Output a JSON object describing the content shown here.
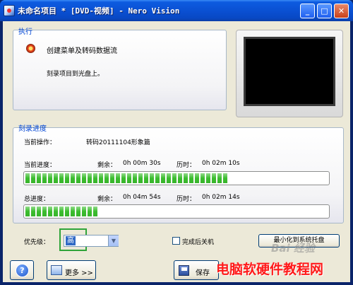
{
  "window": {
    "title": "未命名项目 * [DVD-视频] - Nero Vision",
    "minimize_glyph": "_",
    "maximize_glyph": "□",
    "close_glyph": "✕"
  },
  "execute": {
    "group_title": "执行",
    "step_title": "创建菜单及转码数据流",
    "step_detail": "刻录项目到光盘上。"
  },
  "progress": {
    "group_title": "刻录进度",
    "operation_label": "当前操作：",
    "operation_value": "转码20111104形象篇",
    "current": {
      "label": "当前进度：",
      "remaining_label": "剩余：",
      "remaining_value": "0h 00m 30s",
      "elapsed_label": "历时：",
      "elapsed_value": "0h 02m 10s",
      "fraction": 0.67
    },
    "total": {
      "label": "总进度：",
      "remaining_label": "剩余：",
      "remaining_value": "0h 04m 54s",
      "elapsed_label": "历时：",
      "elapsed_value": "0h 02m 14s",
      "fraction": 0.24
    }
  },
  "options": {
    "priority_label": "优先级：",
    "priority_value": "高",
    "shutdown_label": "完成后关机",
    "shutdown_checked": false,
    "minimize_tray_label": "最小化到系统托盘"
  },
  "buttons": {
    "help_glyph": "?",
    "more_label": "更多 >>",
    "save_label": "保存"
  },
  "watermarks": {
    "baidu": "Bai 经验",
    "site": "电脑软硬件教程网"
  },
  "colors": {
    "title_bar": "#0a4fd1",
    "group_title": "#0046d5",
    "progress_fill": "#3bbd2e",
    "priority_highlight": "#2fa43a"
  }
}
